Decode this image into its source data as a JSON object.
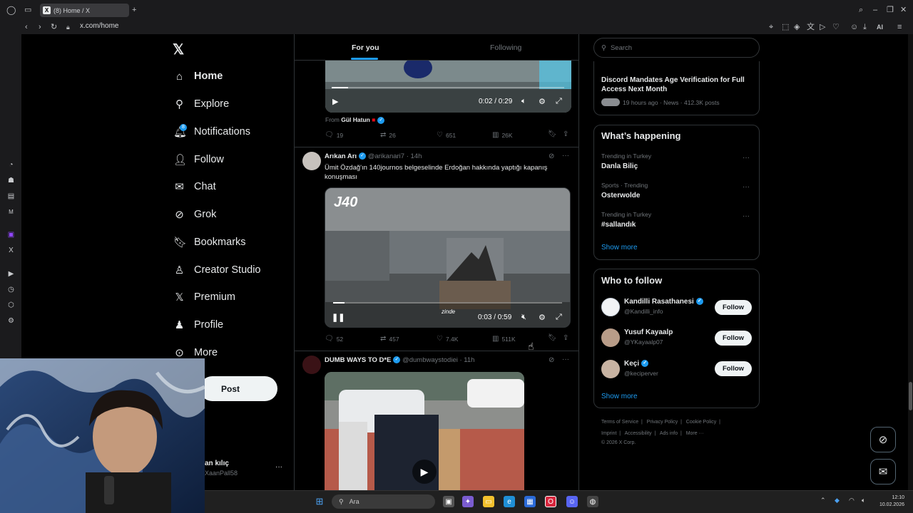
{
  "browser": {
    "tab_title": "(8) Home / X",
    "url": "x.com/home",
    "ai_label": "AI"
  },
  "nav": {
    "items": [
      {
        "label": "Home",
        "icon": "home-icon"
      },
      {
        "label": "Explore",
        "icon": "search-icon"
      },
      {
        "label": "Notifications",
        "icon": "bell-icon"
      },
      {
        "label": "Follow",
        "icon": "person-add-icon"
      },
      {
        "label": "Chat",
        "icon": "mail-icon"
      },
      {
        "label": "Grok",
        "icon": "grok-icon"
      },
      {
        "label": "Bookmarks",
        "icon": "bookmark-icon"
      },
      {
        "label": "Creator Studio",
        "icon": "creator-icon"
      },
      {
        "label": "Premium",
        "icon": "x-icon"
      },
      {
        "label": "Profile",
        "icon": "person-icon"
      },
      {
        "label": "More",
        "icon": "more-circle-icon"
      }
    ],
    "notification_badge": "8",
    "post_label": "Post",
    "account_name": "an kılıç",
    "account_handle": "XaanPall58"
  },
  "feed": {
    "tabs": [
      "For you",
      "Following"
    ],
    "post1": {
      "time": "0:02 / 0:29",
      "progress": 0.07,
      "from_label": "From",
      "from_name": "Gül Hatun",
      "replies": "19",
      "reposts": "26",
      "likes": "651",
      "views": "26K"
    },
    "post2": {
      "name": "Arıkan Arı",
      "handle": "@arikanari7",
      "age": "14h",
      "text": "Ümit Özdağ'ın 140journos belgeselinde Erdoğan hakkında yaptığı kapanış konuşması",
      "watermark": "J40",
      "video_caption": "zinde",
      "time": "0:03 / 0:59",
      "progress": 0.05,
      "replies": "52",
      "reposts": "457",
      "likes": "7.4K",
      "views": "511K"
    },
    "post3": {
      "name": "DUMB WAYS TO D*E",
      "handle": "@dumbwaystodiei",
      "age": "11h"
    }
  },
  "right": {
    "search_placeholder": "Search",
    "news": {
      "title": "Discord Mandates Age Verification for Full Access Next Month",
      "meta": "19 hours ago · News · 412.3K posts"
    },
    "happening_title": "What’s happening",
    "trends": [
      {
        "context": "Trending in Turkey",
        "name": "Danla Biliç"
      },
      {
        "context": "Sports · Trending",
        "name": "Osterwolde"
      },
      {
        "context": "Trending in Turkey",
        "name": "#sallandık"
      }
    ],
    "show_more": "Show more",
    "wtf_title": "Who to follow",
    "follow_label": "Follow",
    "wtf": [
      {
        "name": "Kandilli Rasathanesi",
        "handle": "@Kandilli_info"
      },
      {
        "name": "Yusuf Kayaalp",
        "handle": "@YKayaalp07"
      },
      {
        "name": "Keçi",
        "handle": "@keciperver"
      }
    ],
    "footer_links": [
      "Terms of Service",
      "Privacy Policy",
      "Cookie Policy",
      "Imprint",
      "Accessibility",
      "Ads info",
      "More ···"
    ],
    "copyright": "© 2026 X Corp."
  },
  "taskbar": {
    "search_placeholder": "Ara",
    "time": "12:10",
    "date": "10.02.2026"
  }
}
